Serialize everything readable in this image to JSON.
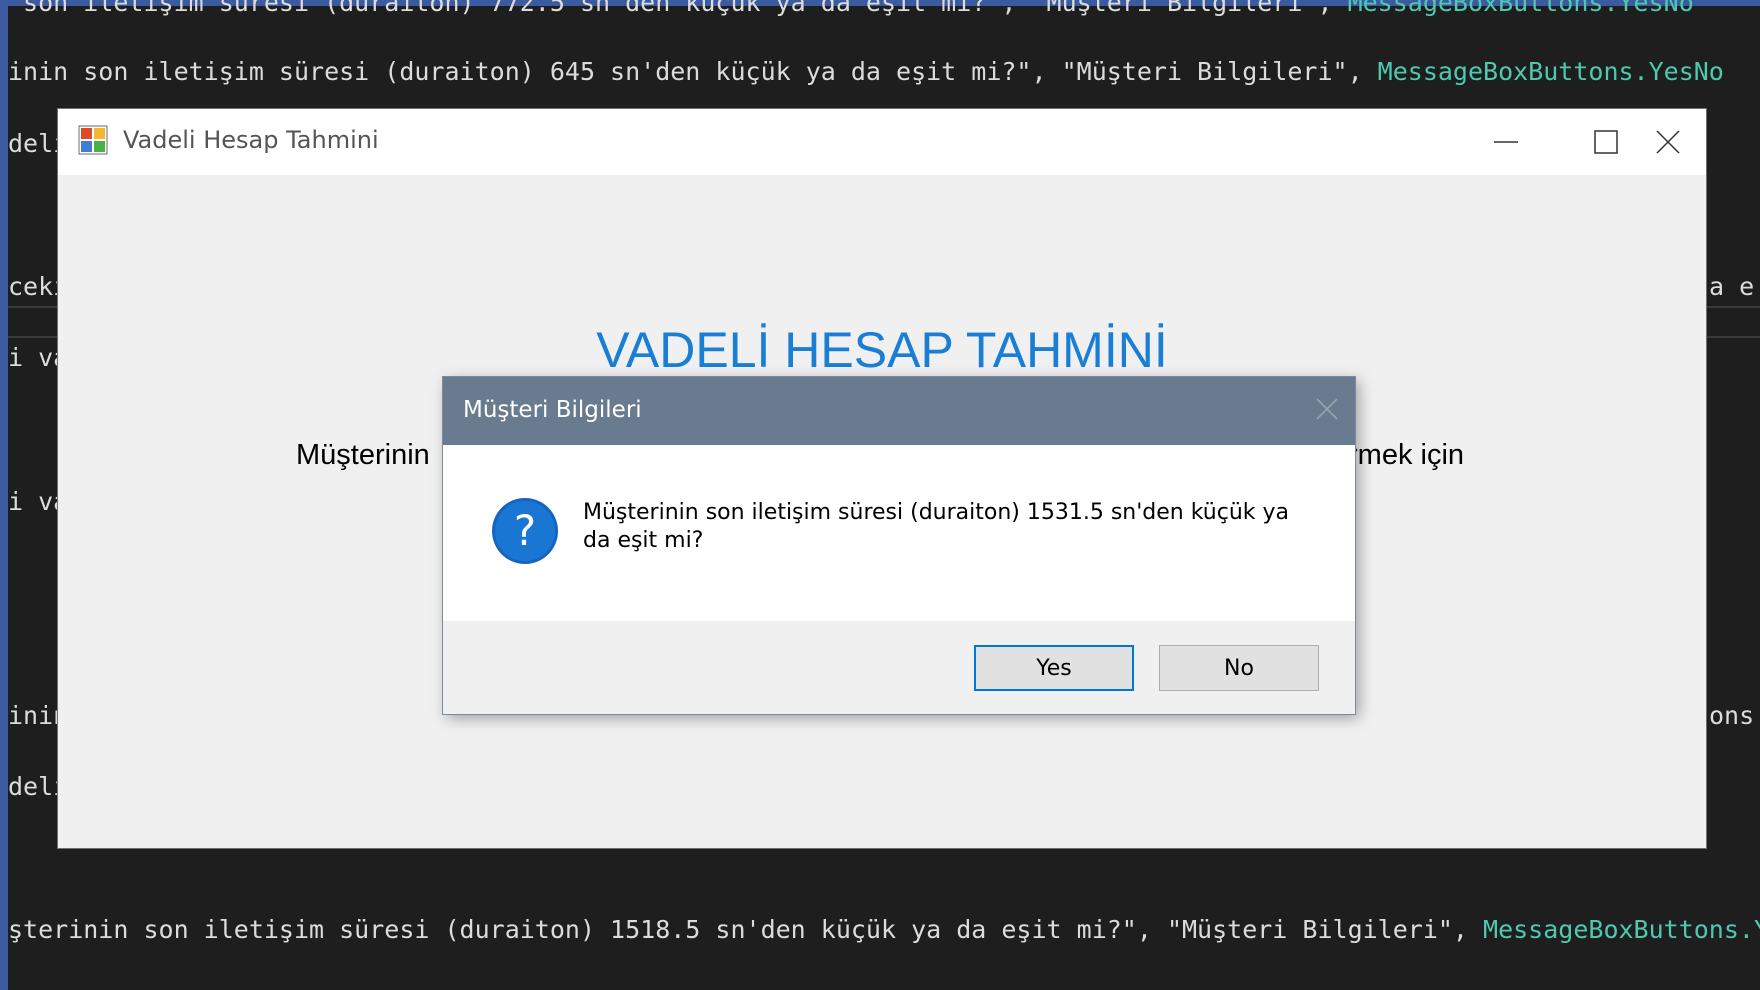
{
  "editor": {
    "lines": [
      {
        "parts": [
          {
            "c": "txt",
            "t": " son iletişim süresi (duraiton) 772.5 sn'den küçük ya da eşit mi?\", \"Müşteri Bilgileri\", "
          },
          {
            "c": "cls",
            "t": "MessageBoxButtons.YesNo"
          }
        ]
      },
      {
        "parts": [
          {
            "c": "txt",
            "t": "inin son iletişim süresi (duraiton) 645 sn'den küçük ya da eşit mi?\", \"Müşteri Bilgileri\", "
          },
          {
            "c": "cls",
            "t": "MessageBoxButtons.YesNo"
          }
        ]
      },
      {
        "parts": [
          {
            "c": "txt",
            "t": "deli"
          }
        ]
      },
      {
        "parts": [
          {
            "c": "txt",
            "t": "ceki"
          }
        ]
      },
      {
        "parts": [
          {
            "c": "txt",
            "t": "a e"
          }
        ]
      },
      {
        "parts": [
          {
            "c": "txt",
            "t": "i va"
          }
        ]
      },
      {
        "parts": [
          {
            "c": "txt",
            "t": "i va"
          }
        ]
      },
      {
        "parts": [
          {
            "c": "txt",
            "t": "inin"
          }
        ]
      },
      {
        "parts": [
          {
            "c": "txt",
            "t": "ons"
          }
        ]
      },
      {
        "parts": [
          {
            "c": "txt",
            "t": "deli"
          }
        ]
      },
      {
        "parts": [
          {
            "c": "txt",
            "t": "şterinin son iletişim süresi (duraiton) 1518.5 sn'den küçük ya da eşit mi?\", \"Müşteri Bilgileri\", "
          },
          {
            "c": "cls",
            "t": "MessageBoxButtons.YesNo"
          }
        ]
      }
    ]
  },
  "window": {
    "title": "Vadeli Hesap Tahmini",
    "heading": "VADELİ HESAP TAHMİNİ",
    "sub_left": "Müşterinin",
    "sub_right": "rmek için",
    "controls": [
      "minimize-icon",
      "maximize-icon",
      "close-icon"
    ]
  },
  "dialog": {
    "title": "Müşteri Bilgileri",
    "icon": "question-icon",
    "message": "Müşterinin son iletişim süresi (duraiton) 1531.5 sn'den küçük ya da eşit mi?",
    "buttons": {
      "yes": "Yes",
      "no": "No"
    }
  },
  "colors": {
    "accent": "#1a7fd4",
    "dialog_titlebar": "#697b8e",
    "focus_border": "#0078d7"
  }
}
